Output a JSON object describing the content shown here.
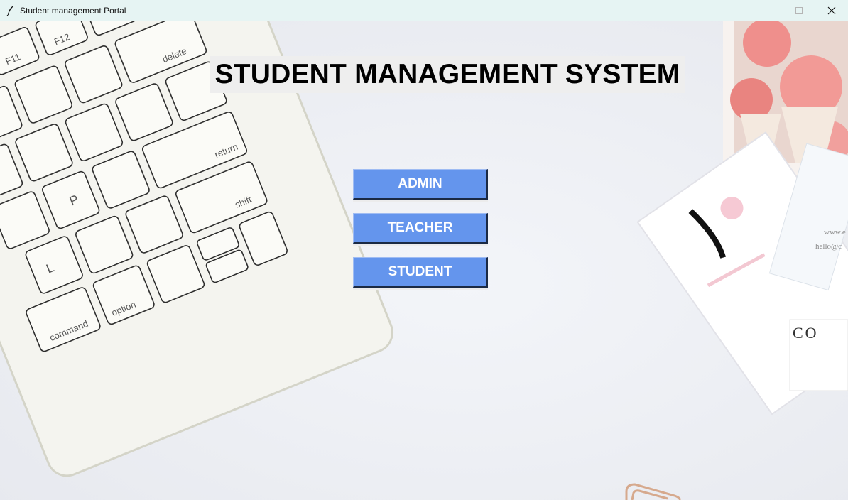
{
  "window": {
    "title": "Student management Portal",
    "icons": {
      "app": "feather-icon",
      "minimize": "minimize-icon",
      "maximize": "maximize-icon",
      "close": "close-icon"
    }
  },
  "main": {
    "heading": "STUDENT MANAGEMENT SYSTEM",
    "buttons": {
      "admin": "ADMIN",
      "teacher": "TEACHER",
      "student": "STUDENT"
    },
    "accent_color": "#6495ed"
  },
  "background": {
    "keyboard_keys": {
      "f11": "F11",
      "f12": "F12",
      "delete": "delete",
      "return": "return",
      "shift": "shift",
      "option": "option",
      "command": "command",
      "p": "P",
      "l": "L"
    },
    "card_text": "CO",
    "card_small_1": "www.e",
    "card_small_2": "hello@c"
  }
}
